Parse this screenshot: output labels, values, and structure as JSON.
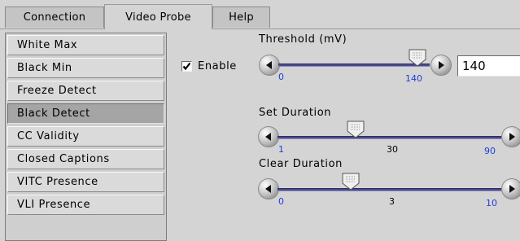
{
  "tabs": [
    {
      "label": "Connection"
    },
    {
      "label": "Video Probe"
    },
    {
      "label": "Help"
    }
  ],
  "sidebar": {
    "items": [
      {
        "label": "White Max"
      },
      {
        "label": "Black Min"
      },
      {
        "label": "Freeze Detect"
      },
      {
        "label": "Black Detect"
      },
      {
        "label": "CC Validity"
      },
      {
        "label": "Closed Captions"
      },
      {
        "label": "VITC Presence"
      },
      {
        "label": "VLI Presence"
      }
    ],
    "active_index": 3
  },
  "enable": {
    "label": "Enable",
    "checked": true
  },
  "threshold": {
    "title": "Threshold (mV)",
    "min_label": "0",
    "value_label": "140",
    "input_value": "140",
    "min": 0,
    "max": 140,
    "value": 140
  },
  "set_duration": {
    "title": "Set Duration",
    "min_label": "1",
    "value_label": "30",
    "max_label": "90",
    "min": 1,
    "max": 90,
    "value": 30
  },
  "clear_duration": {
    "title": "Clear Duration",
    "min_label": "0",
    "value_label": "3",
    "max_label": "10",
    "min": 0,
    "max": 10,
    "value": 3
  },
  "colors": {
    "tick_blue": "#1f3dd6",
    "track": "#4a4a8a",
    "active_item": "#a5a5a5"
  },
  "icons": {
    "left": "left-arrow-icon",
    "right": "right-arrow-icon",
    "thumb": "slider-thumb-icon",
    "check": "checkmark-icon"
  }
}
